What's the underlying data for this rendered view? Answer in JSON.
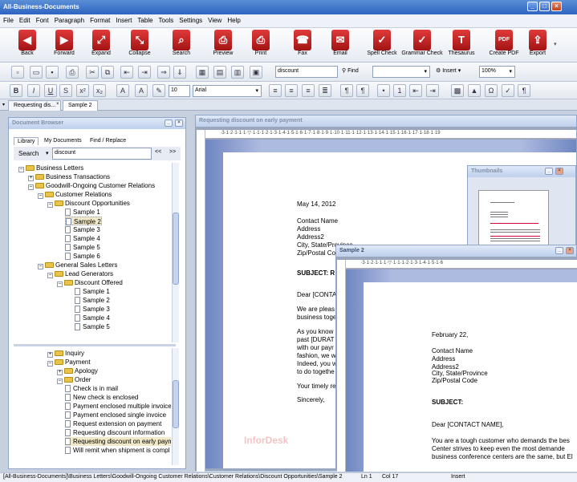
{
  "window": {
    "title": "All-Business-Documents"
  },
  "menu": [
    "File",
    "Edit",
    "Font",
    "Paragraph",
    "Format",
    "Insert",
    "Table",
    "Tools",
    "Settings",
    "View",
    "Help"
  ],
  "toolbar_big": [
    {
      "label": "Back",
      "icon": "back-arrow-icon",
      "glyph": "◀"
    },
    {
      "label": "Forward",
      "icon": "forward-arrow-icon",
      "glyph": "▶"
    },
    {
      "label": "Expand",
      "icon": "expand-icon",
      "glyph": "⤢"
    },
    {
      "label": "Collapse",
      "icon": "collapse-icon",
      "glyph": "⤡"
    },
    {
      "label": "Search",
      "icon": "search-icon",
      "glyph": "⌕"
    },
    {
      "label": "Preview",
      "icon": "preview-icon",
      "glyph": "⎙"
    },
    {
      "label": "Print",
      "icon": "print-icon",
      "glyph": "⎙"
    },
    {
      "label": "Fax",
      "icon": "fax-icon",
      "glyph": "☎"
    },
    {
      "label": "Email",
      "icon": "email-icon",
      "glyph": "✉"
    },
    {
      "label": "Spell Check",
      "icon": "spell-check-icon",
      "glyph": "✓"
    },
    {
      "label": "Grammar Check",
      "icon": "grammar-check-icon",
      "glyph": "✓"
    },
    {
      "label": "Thesaurus",
      "icon": "thesaurus-icon",
      "glyph": "T"
    },
    {
      "label": "Create PDF",
      "icon": "pdf-icon",
      "glyph": "PDF"
    },
    {
      "label": "Export",
      "icon": "export-icon",
      "glyph": "⇪"
    }
  ],
  "find": {
    "value": "discount",
    "button": "Find"
  },
  "insert_label": "Insert",
  "zoom": "100%",
  "format": {
    "font_size": "10",
    "font_name": "Arial"
  },
  "tabs": [
    "Requesting dis...",
    "Sample 2"
  ],
  "browser": {
    "title": "Document Browser",
    "tabs": [
      "Library",
      "My Documents",
      "Find / Replace"
    ],
    "search_label": "Search",
    "search_value": "discount",
    "prev": "<<",
    "next": ">>",
    "tree": [
      "Business Letters",
      "Business Transactions",
      "Goodwill-Ongoing Customer Relations",
      "Customer Relations",
      "Discount Opportunities",
      "Sample 1",
      "Sample 2",
      "Sample 3",
      "Sample 4",
      "Sample 5",
      "Sample 6",
      "General Sales Letters",
      "Lead Generators",
      "Discount Offered",
      "Sample 1",
      "Sample 2",
      "Sample 3",
      "Sample 4",
      "Sample 5"
    ],
    "list": [
      "Inquiry",
      "Payment",
      "Apology",
      "Order",
      "Check is in mail",
      "New check is enclosed",
      "Payment enclosed multiple invoice",
      "Payment enclosed single invoice",
      "Request extension on payment",
      "Requesting discount information",
      "Requesting discount on early paym",
      "Will remit when shipment is compl"
    ]
  },
  "doc1": {
    "title": "Requesting discount on early payment",
    "lines": [
      "May 14, 2012",
      "Contact Name",
      "Address",
      "Address2",
      "City, State/Province",
      "Zip/Postal Code",
      "SUBJECT: R",
      "Dear [CONTACT",
      "We are pleas",
      "business toge",
      "As you know",
      "past [DURAT",
      "with our payr",
      "fashion, we w",
      "Indeed, you w",
      "to do togethe",
      "Your timely re",
      "Sincerely,"
    ]
  },
  "doc2": {
    "title": "Sample 2",
    "lines": [
      "February 22,",
      "Contact Name",
      "Address",
      "Address2",
      "City, State/Province",
      "Zip/Postal Code",
      "SUBJECT:",
      "Dear [CONTACT NAME],",
      "You are a tough customer who demands the bes",
      "Center strives to keep even the most demande",
      "business conference centers are the same, but El"
    ]
  },
  "thumbnails": {
    "title": "Thumbnails",
    "page": "1"
  },
  "watermark": "InforDesk",
  "status": {
    "path": "[All-Business-Documents]\\Business Letters\\Goodwill-Ongoing Customer Relations\\Customer Relations\\Discount Opportunities\\Sample 2",
    "ln": "Ln 1",
    "col": "Col 17",
    "mode": "Insert"
  },
  "colors": {
    "title_bar": "#2d64c0",
    "icon_red": "#c41e1e",
    "selection": "#f0e8c8"
  }
}
